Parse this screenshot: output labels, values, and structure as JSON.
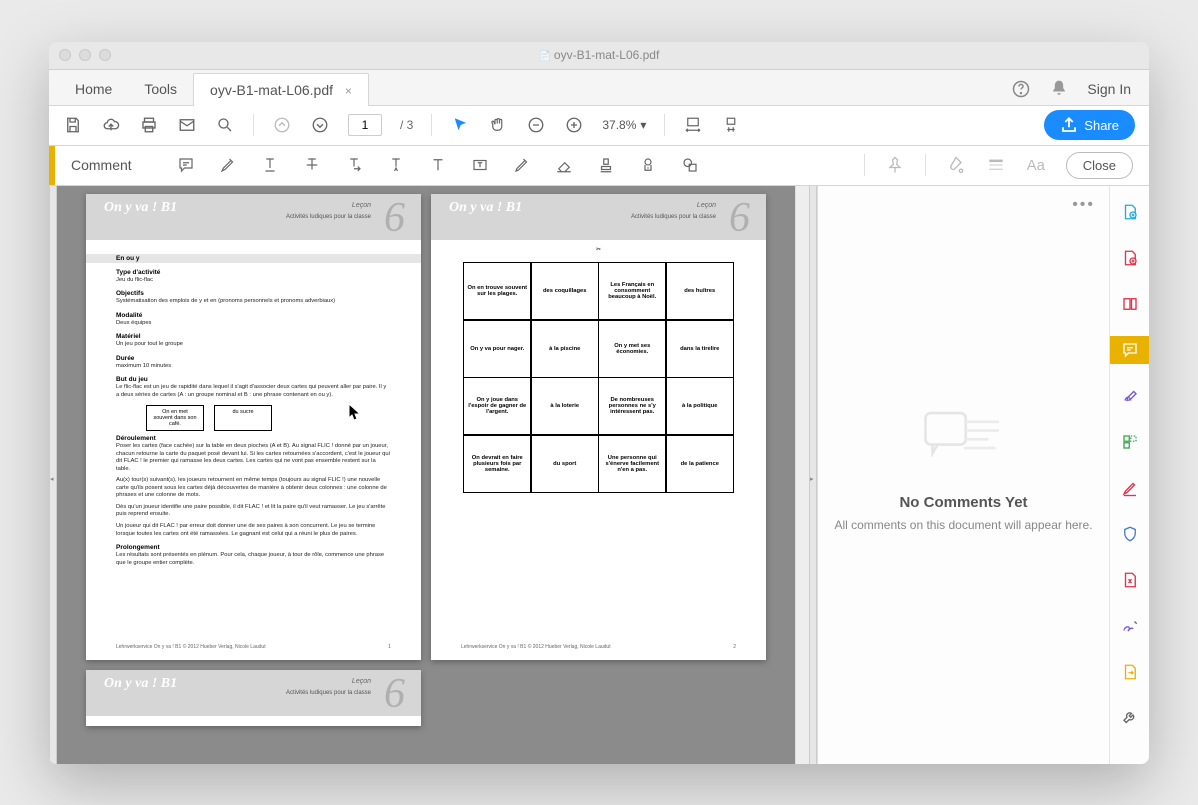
{
  "window": {
    "title": "oyv-B1-mat-L06.pdf"
  },
  "tabs": {
    "home": "Home",
    "tools": "Tools",
    "doc": "oyv-B1-mat-L06.pdf",
    "sign_in": "Sign In"
  },
  "toolbar": {
    "page_current": "1",
    "page_total": "/ 3",
    "zoom": "37.8%",
    "share": "Share"
  },
  "comment_bar": {
    "label": "Comment",
    "close": "Close"
  },
  "comments_panel": {
    "heading": "No Comments Yet",
    "sub": "All comments on this document will appear here."
  },
  "doc": {
    "series_title": "On y va ! B1",
    "lesson_label": "Leçon",
    "lesson_num": "6",
    "subtitle": "Activités ludiques pour la classe",
    "footer": "Lehrwerkservice On y va ! B1 © 2012 Hueber Verlag, Nicole Laudut",
    "page1": {
      "h0": "En ou y",
      "s1_h": "Type d'activité",
      "s1_t": "Jeu du flic-flac",
      "s2_h": "Objectifs",
      "s2_t": "Systématisation des emplois de y et en (pronoms personnels et pronoms adverbiaux)",
      "s3_h": "Modalité",
      "s3_t": "Deux équipes",
      "s4_h": "Matériel",
      "s4_t": "Un jeu pour tout le groupe",
      "s5_h": "Durée",
      "s5_t": "maximum 10 minutes",
      "s6_h": "But du jeu",
      "s6_t": "Le flic-flac est un jeu de rapidité dans lequel il s'agit d'associer deux cartes qui peuvent aller par paire. Il y a deux séries de cartes (A : un groupe nominal et B : une phrase contenant en ou y).",
      "card_a": "On en met souvent dans son café.",
      "card_b": "du sucre",
      "s7_h": "Déroulement",
      "s7_t1": "Poser les cartes (face cachée) sur la table en deux pioches (A et B). Au signal FLIC ! donné par un joueur, chacun retourne la carte du paquet posé devant lui. Si les cartes retournées s'accordent, c'est le joueur qui dit FLAC ! le premier qui ramasse les deux cartes. Les cartes qui ne vont pas ensemble restent sur la table.",
      "s7_t2": "Au(x) tour(s) suivant(s), les joueurs retournent en même temps (toujours au signal FLIC !) une nouvelle carte qu'ils posent sous les cartes déjà découvertes de manière à obtenir deux colonnes : une colonne de phrases et une colonne de mots.",
      "s7_t3": "Dès qu'un joueur identifie une paire possible, il dit FLAC ! et lit la paire qu'il veut ramasser. Le jeu s'arrête puis reprend ensuite.",
      "s7_t4": "Un joueur qui dit FLAC ! par erreur doit donner une de ses paires à son concurrent. Le jeu se termine lorsque toutes les cartes ont été ramassées. Le gagnant est celui qui a réuni le plus de paires.",
      "s8_h": "Prolongement",
      "s8_t": "Les résultats sont présentés en plénum. Pour cela, chaque joueur, à tour de rôle, commence une phrase que le groupe entier complète.",
      "pnum": "1"
    },
    "page2": {
      "cells": [
        "On en trouve souvent sur les plages.",
        "des coquillages",
        "Les Français en consomment beaucoup à Noël.",
        "des huîtres",
        "On y va pour nager.",
        "à la piscine",
        "On y met ses économies.",
        "dans la tirelire",
        "On y joue dans l'espoir de gagner de l'argent.",
        "à la loterie",
        "De nombreuses personnes ne s'y intéressent pas.",
        "à la politique",
        "On devrait en faire plusieurs fois par semaine.",
        "du sport",
        "Une personne qui s'énerve facilement n'en a pas.",
        "de la patience"
      ],
      "pnum": "2"
    }
  }
}
